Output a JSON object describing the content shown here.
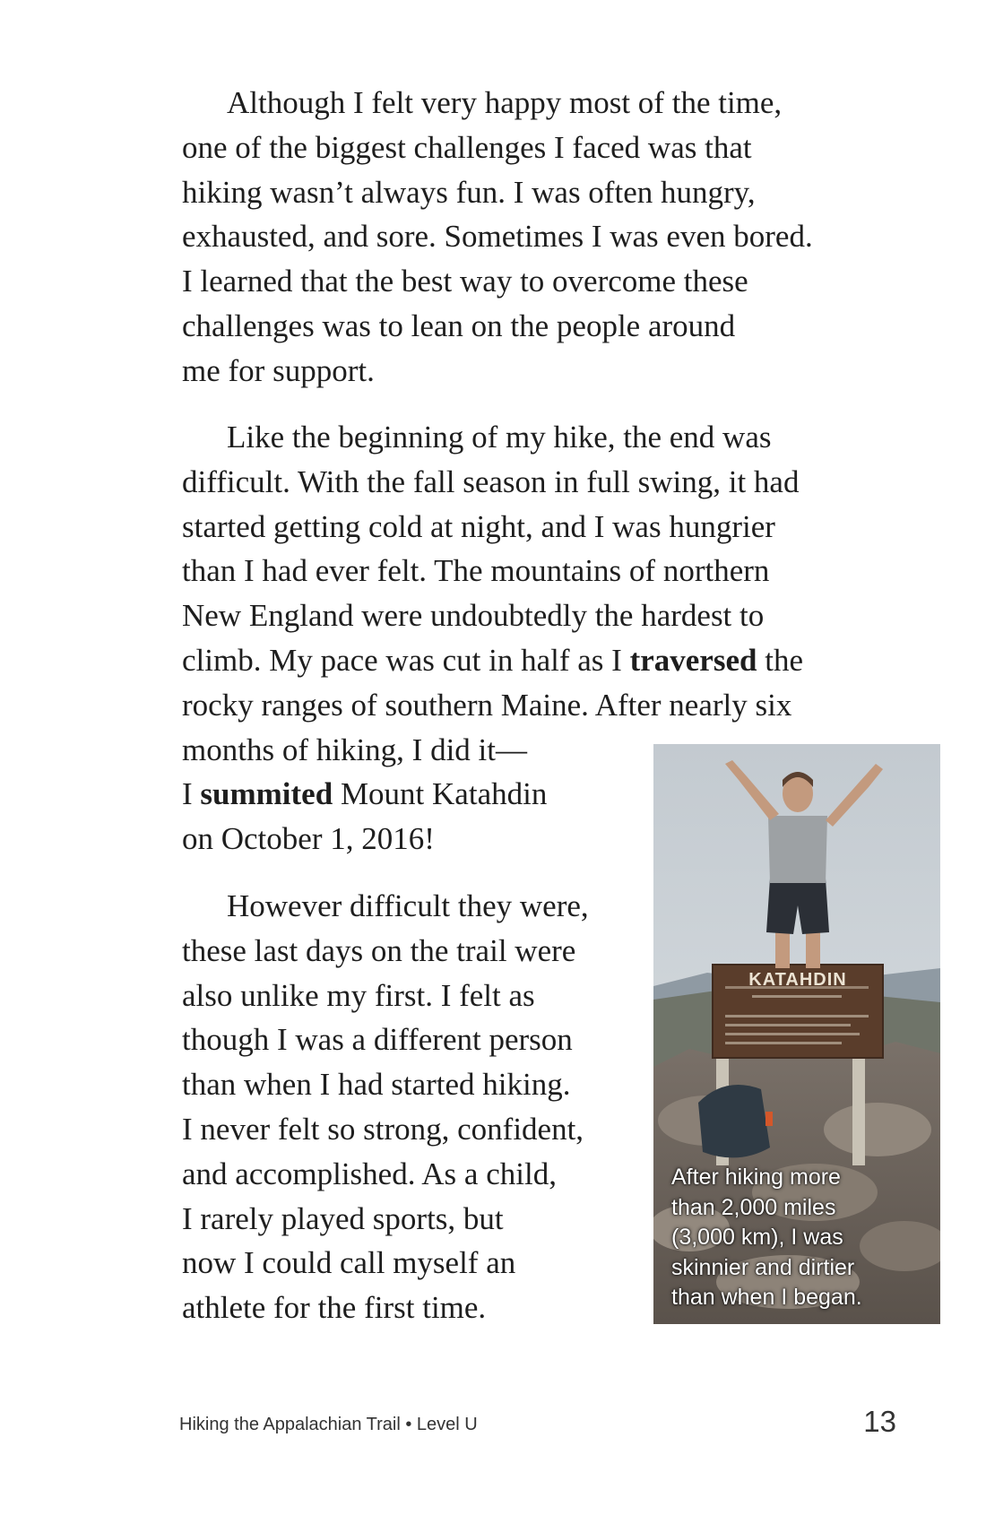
{
  "paragraphs": {
    "p1": [
      "Although I felt very happy most of the time,",
      "one of the biggest challenges I faced was that",
      "hiking wasn’t always fun. I was often hungry,",
      "exhausted, and sore. Sometimes I was even bored.",
      "I learned that the best way to overcome these",
      "challenges was to lean on the people around",
      "me for support."
    ],
    "p2": {
      "l1": "Like the beginning of my hike, the end was",
      "l2": "difficult. With the fall season in full swing, it had",
      "l3": "started getting cold at night, and I was hungrier",
      "l4": "than I had ever felt. The mountains of northern",
      "l5": "New England were undoubtedly the hardest to",
      "l6_pre": "climb. My pace was cut in half as I ",
      "l6_bold": "traversed",
      "l6_post": " the",
      "l7": "rocky ranges of southern Maine. After nearly six",
      "l8": "months of hiking, I did it—",
      "l9_pre": "I ",
      "l9_bold": "summited",
      "l9_post": " Mount Katahdin",
      "l10": "on October 1, 2016!"
    },
    "p3": [
      "However difficult they were,",
      "these last days on the trail were",
      "also unlike my first. I felt as",
      "though I was a different person",
      "than when I had started hiking.",
      "I never felt so strong, confident,",
      "and accomplished. As a child,",
      "I rarely played sports, but",
      "now I could call myself an",
      "athlete for the first time."
    ]
  },
  "photo": {
    "sign_title": "KATAHDIN",
    "caption": [
      "After hiking more",
      "than 2,000 miles",
      "(3,000 km), I was",
      "skinnier and dirtier",
      "than when I began."
    ]
  },
  "footer": {
    "title": "Hiking the Appalachian Trail • Level U",
    "page_number": "13"
  }
}
